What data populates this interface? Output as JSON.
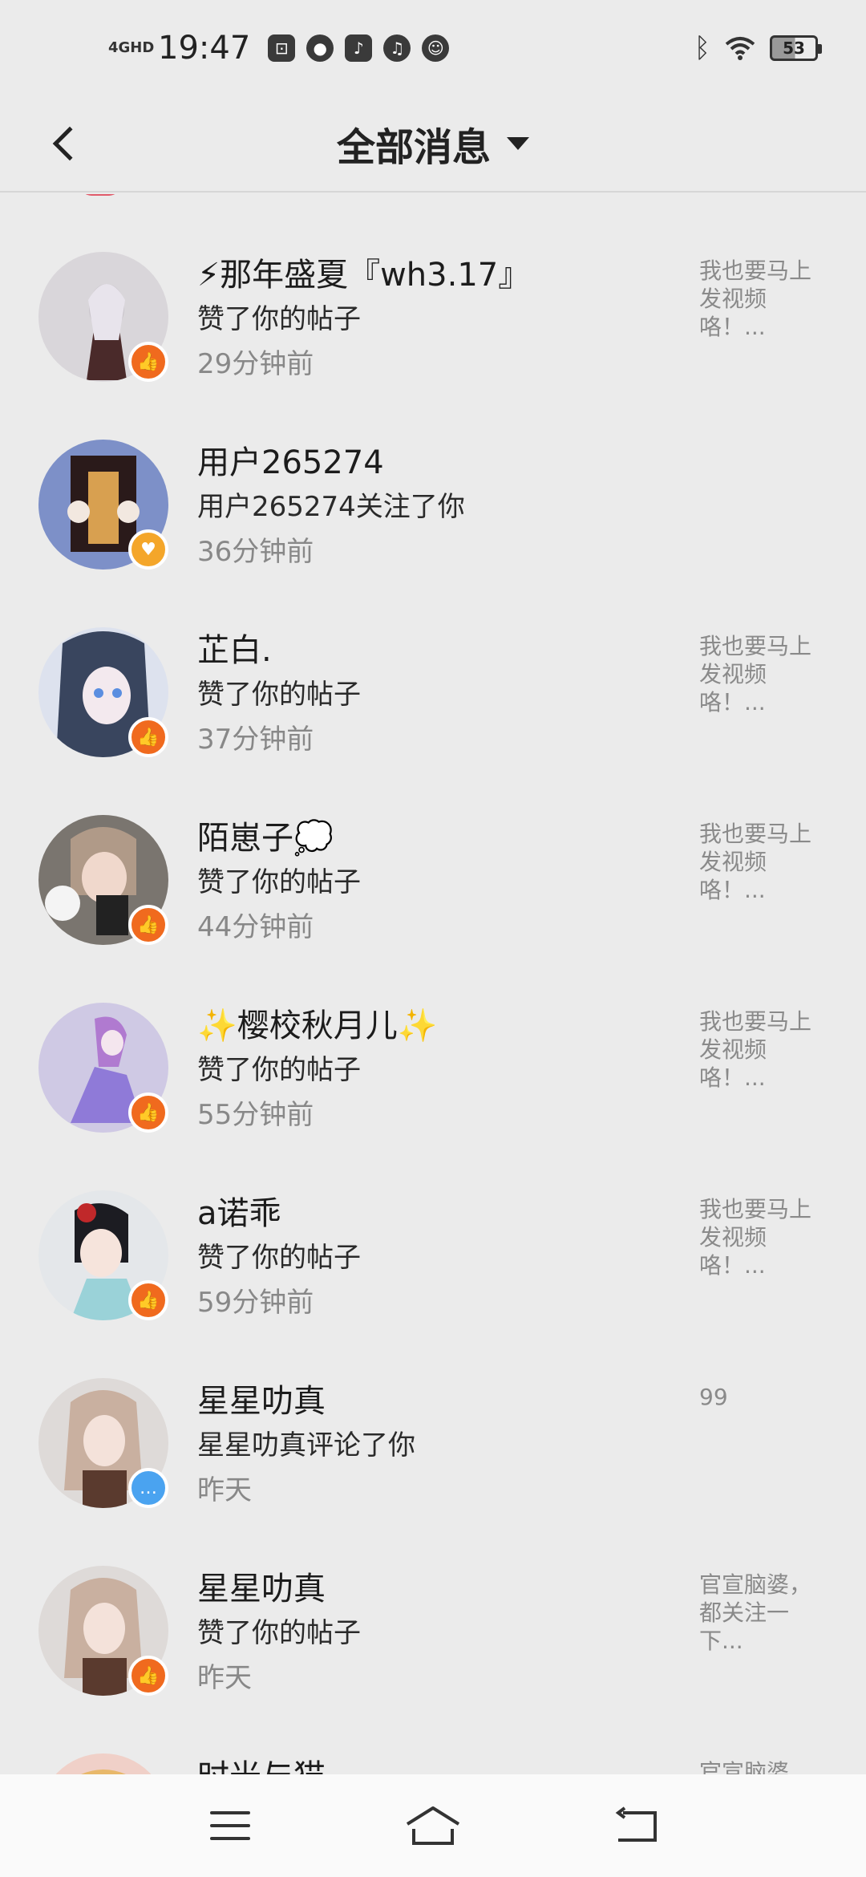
{
  "status_bar": {
    "network": "4GHD",
    "time": "19:47",
    "battery": "53",
    "icons": [
      "scan-app-icon",
      "wechat-icon",
      "tiktok-icon",
      "music-icon",
      "bot-icon",
      "bluetooth-icon",
      "wifi-icon",
      "battery-icon"
    ]
  },
  "header": {
    "title": "全部消息",
    "back_icon": "chevron-left-icon",
    "dropdown_icon": "caret-down-icon"
  },
  "colors": {
    "like_badge": "#f06a1e",
    "follow_badge": "#f4a62a",
    "comment_badge": "#4aa3f0",
    "background": "#ebebeb"
  },
  "messages": [
    {
      "name": "⚡那年盛夏『wh3.17』",
      "action": "赞了你的帖子",
      "time": "29分钟前",
      "preview": "我也要马上发视频咯！...",
      "badge": "like"
    },
    {
      "name": "用户265274",
      "action": "用户265274关注了你",
      "time": "36分钟前",
      "preview": "",
      "badge": "follow"
    },
    {
      "name": "芷白.",
      "action": "赞了你的帖子",
      "time": "37分钟前",
      "preview": "我也要马上发视频咯！...",
      "badge": "like"
    },
    {
      "name": "陌崽子💭",
      "action": "赞了你的帖子",
      "time": "44分钟前",
      "preview": "我也要马上发视频咯！...",
      "badge": "like"
    },
    {
      "name": "✨樱校秋月儿✨",
      "action": "赞了你的帖子",
      "time": "55分钟前",
      "preview": "我也要马上发视频咯！...",
      "badge": "like"
    },
    {
      "name": "a诺乖",
      "action": "赞了你的帖子",
      "time": "59分钟前",
      "preview": "我也要马上发视频咯！...",
      "badge": "like"
    },
    {
      "name": "星星叻真",
      "action": "星星叻真评论了你",
      "time": "昨天",
      "preview": "99",
      "badge": "comment"
    },
    {
      "name": "星星叻真",
      "action": "赞了你的帖子",
      "time": "昨天",
      "preview": "官宣脑婆，都关注一下...",
      "badge": "like"
    },
    {
      "name": "时光与猫",
      "action": "",
      "time": "",
      "preview": "官宣脑婆",
      "badge": "like"
    }
  ],
  "nav": {
    "menu_icon": "menu-icon",
    "home_icon": "home-icon",
    "back_icon": "return-icon"
  }
}
